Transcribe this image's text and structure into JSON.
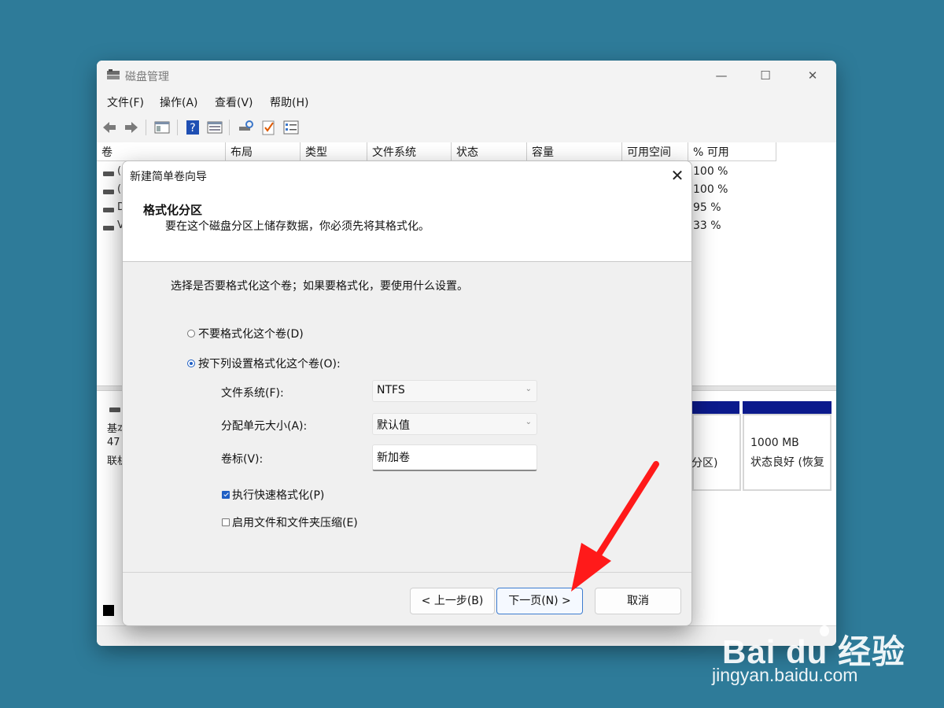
{
  "window": {
    "title": "磁盘管理",
    "menu": [
      "文件(F)",
      "操作(A)",
      "查看(V)",
      "帮助(H)"
    ],
    "controls": {
      "minimize": "—",
      "maximize": "☐",
      "close": "✕"
    }
  },
  "volume_table": {
    "columns": [
      "卷",
      "布局",
      "类型",
      "文件系统",
      "状态",
      "容量",
      "可用空间",
      "% 可用"
    ],
    "row_fragments": [
      "(",
      "(",
      "D",
      "V"
    ],
    "percent_free": [
      "100 %",
      "100 %",
      "95 %",
      "33 %"
    ]
  },
  "disk_view": {
    "label_fragments": [
      "基本",
      "47",
      "联机"
    ],
    "partition_text": "分区)",
    "recovery_size": "1000 MB",
    "recovery_status": "状态良好 (恢复"
  },
  "dialog": {
    "title": "新建简单卷向导",
    "close": "✕",
    "heading": "格式化分区",
    "subheading": "要在这个磁盘分区上储存数据，你必须先将其格式化。",
    "instruction": "选择是否要格式化这个卷；如果要格式化，要使用什么设置。",
    "option_no_format": "不要格式化这个卷(D)",
    "option_format": "按下列设置格式化这个卷(O):",
    "selected_option": "format",
    "fields": {
      "filesystem_label": "文件系统(F):",
      "filesystem_value": "NTFS",
      "alloc_label": "分配单元大小(A):",
      "alloc_value": "默认值",
      "volume_label_label": "卷标(V):",
      "volume_label_value": "新加卷"
    },
    "quick_format": {
      "label": "执行快速格式化(P)",
      "checked": true
    },
    "compression": {
      "label": "启用文件和文件夹压缩(E)",
      "checked": false
    },
    "buttons": {
      "back": "< 上一步(B)",
      "next": "下一页(N) >",
      "cancel": "取消"
    }
  },
  "annotation": {
    "arrow_color": "#ff1a1a"
  },
  "watermark": {
    "brand": "Bai du 经验",
    "url": "jingyan.baidu.com"
  },
  "colors": {
    "background": "#2e7b99",
    "accent": "#1f5fc4",
    "volume_bar": "#0b1a8c"
  }
}
